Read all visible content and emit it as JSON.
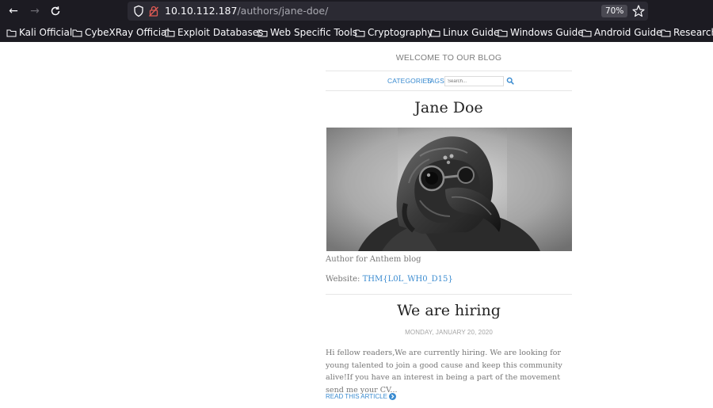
{
  "browser": {
    "url_host": "10.10.112.187",
    "url_path": "/authors/jane-doe/",
    "zoom": "70%"
  },
  "bookmarks": [
    {
      "label": "Kali Official"
    },
    {
      "label": "CybeXRay Official"
    },
    {
      "label": "Exploit Databases"
    },
    {
      "label": "Web Specific Tools"
    },
    {
      "label": "Cryptography"
    },
    {
      "label": "Linux Guide"
    },
    {
      "label": "Windows Guide"
    },
    {
      "label": "Android Guide"
    },
    {
      "label": "Research"
    }
  ],
  "site": {
    "title": "WELCOME TO OUR BLOG",
    "nav": {
      "categories": "CATEGORIES",
      "tags": "TAGS",
      "search_placeholder": "Search..."
    }
  },
  "author": {
    "name": "Jane Doe",
    "bio": "Author for Anthem blog",
    "website_label": "Website:",
    "website_link": "THM{L0L_WH0_D15}"
  },
  "post": {
    "title": "We are hiring",
    "date": "MONDAY, JANUARY 20, 2020",
    "excerpt": "Hi fellow readers,We are currently hiring. We are looking for young talented to join a good cause and keep this community alive!If you have an interest in being a part of the movement send me your CV...",
    "read_more": "READ THIS ARTICLE"
  },
  "colors": {
    "chrome_bg": "#1c1b22",
    "urlbar_bg": "#2b2a33",
    "link": "#3a8bd0"
  }
}
